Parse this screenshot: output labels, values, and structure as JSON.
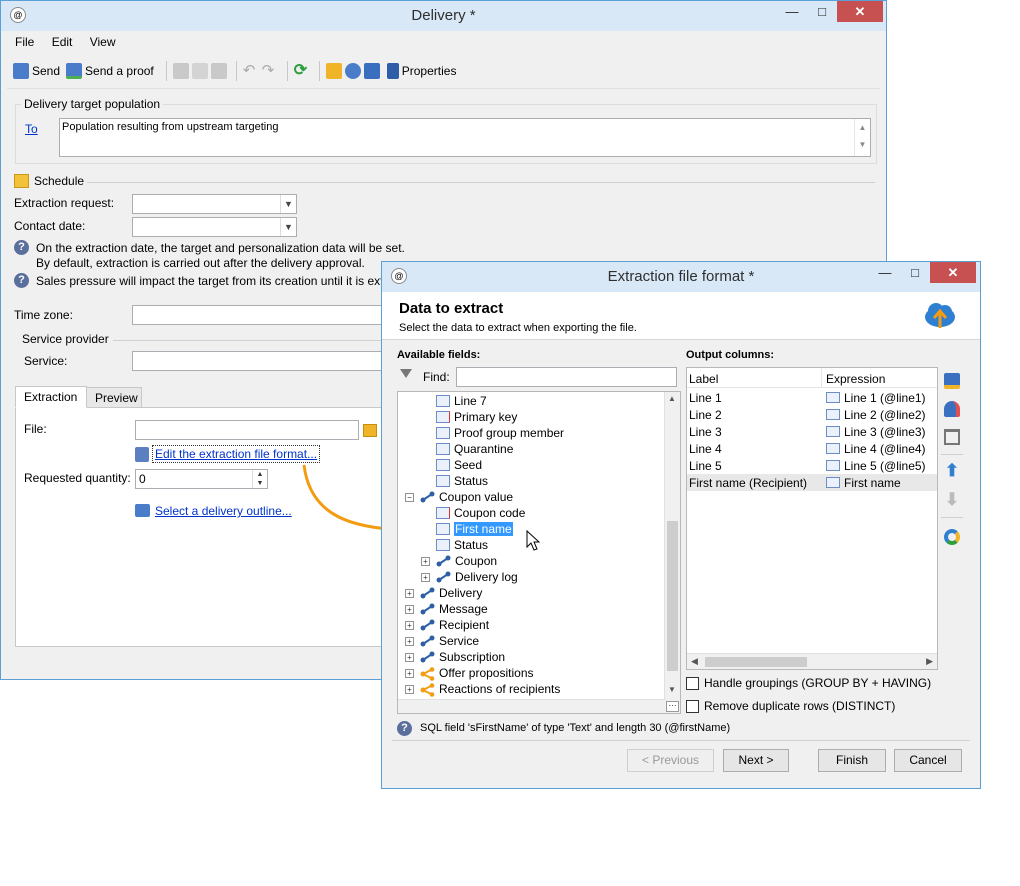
{
  "delivery_window": {
    "title": "Delivery *",
    "menu": [
      "File",
      "Edit",
      "View"
    ],
    "toolbar": {
      "send": "Send",
      "send_proof": "Send a proof",
      "properties": "Properties"
    },
    "target_group": "Delivery target population",
    "to_link": "To",
    "to_value": "Population resulting from upstream targeting",
    "schedule_label": "Schedule",
    "extraction_request_label": "Extraction request:",
    "contact_date_label": "Contact date:",
    "info_line1": "On the extraction date, the target and personalization data will be set.",
    "info_line2": "By default, extraction is carried out after the delivery approval.",
    "info_line3": "Sales pressure will impact the target from its creation until it is extr",
    "time_zone_label": "Time zone:",
    "service_provider_label": "Service provider",
    "service_label": "Service:",
    "tabs": [
      "Extraction",
      "Preview"
    ],
    "file_label": "File:",
    "edit_format_link": "Edit the extraction file format...",
    "requested_quantity_label": "Requested quantity:",
    "requested_quantity_value": "0",
    "select_outline_link": "Select a delivery outline..."
  },
  "dialog": {
    "title": "Extraction file format *",
    "header_title": "Data to extract",
    "header_subtitle": "Select the data to extract when exporting the file.",
    "available_fields_label": "Available fields:",
    "find_label": "Find:",
    "output_columns_label": "Output columns:",
    "tree": [
      {
        "label": "Line 7",
        "icon": "field-icon",
        "level": 2
      },
      {
        "label": "Primary key",
        "icon": "field-key-icon",
        "level": 2
      },
      {
        "label": "Proof group member",
        "icon": "field-icon",
        "level": 2
      },
      {
        "label": "Quarantine",
        "icon": "field-icon",
        "level": 2
      },
      {
        "label": "Seed",
        "icon": "field-icon",
        "level": 2
      },
      {
        "label": "Status",
        "icon": "field-icon",
        "level": 2
      },
      {
        "label": "Coupon value",
        "icon": "link-icon",
        "level": 1,
        "expander": "−"
      },
      {
        "label": "Coupon code",
        "icon": "field-key-icon",
        "level": 2
      },
      {
        "label": "First name",
        "icon": "field-icon",
        "level": 2,
        "selected": true
      },
      {
        "label": "Status",
        "icon": "field-icon",
        "level": 2
      },
      {
        "label": "Coupon",
        "icon": "link-icon",
        "level": 2,
        "expander": "+"
      },
      {
        "label": "Delivery log",
        "icon": "link-icon",
        "level": 2,
        "expander": "+"
      },
      {
        "label": "Delivery",
        "icon": "link-icon",
        "level": 1,
        "expander": "+"
      },
      {
        "label": "Message",
        "icon": "link-icon",
        "level": 1,
        "expander": "+"
      },
      {
        "label": "Recipient",
        "icon": "link-icon",
        "level": 1,
        "expander": "+"
      },
      {
        "label": "Service",
        "icon": "link-icon",
        "level": 1,
        "expander": "+"
      },
      {
        "label": "Subscription",
        "icon": "link-icon",
        "level": 1,
        "expander": "+"
      },
      {
        "label": "Offer propositions",
        "icon": "collection-icon",
        "level": 1,
        "expander": "+"
      },
      {
        "label": "Reactions of recipients",
        "icon": "collection-icon",
        "level": 1,
        "expander": "+"
      }
    ],
    "columns_header": [
      "Label",
      "Expression"
    ],
    "columns": [
      {
        "label": "Line 1",
        "expression": "Line 1 (@line1)"
      },
      {
        "label": "Line 2",
        "expression": "Line 2 (@line2)"
      },
      {
        "label": "Line 3",
        "expression": "Line 3 (@line3)"
      },
      {
        "label": "Line 4",
        "expression": "Line 4 (@line4)"
      },
      {
        "label": "Line 5",
        "expression": "Line 5 (@line5)"
      },
      {
        "label": "First name (Recipient)",
        "expression": "First name"
      }
    ],
    "handle_groupings": "Handle groupings (GROUP BY + HAVING)",
    "remove_duplicates": "Remove duplicate rows (DISTINCT)",
    "status_text": "SQL field 'sFirstName' of type 'Text' and length 30 (@firstName)",
    "buttons": {
      "previous": "< Previous",
      "next": "Next >",
      "finish": "Finish",
      "cancel": "Cancel"
    }
  },
  "colors": {
    "accent": "#3399ff",
    "selection": "#3399ff",
    "arrow": "#f39c12",
    "link": "#0033cc"
  }
}
